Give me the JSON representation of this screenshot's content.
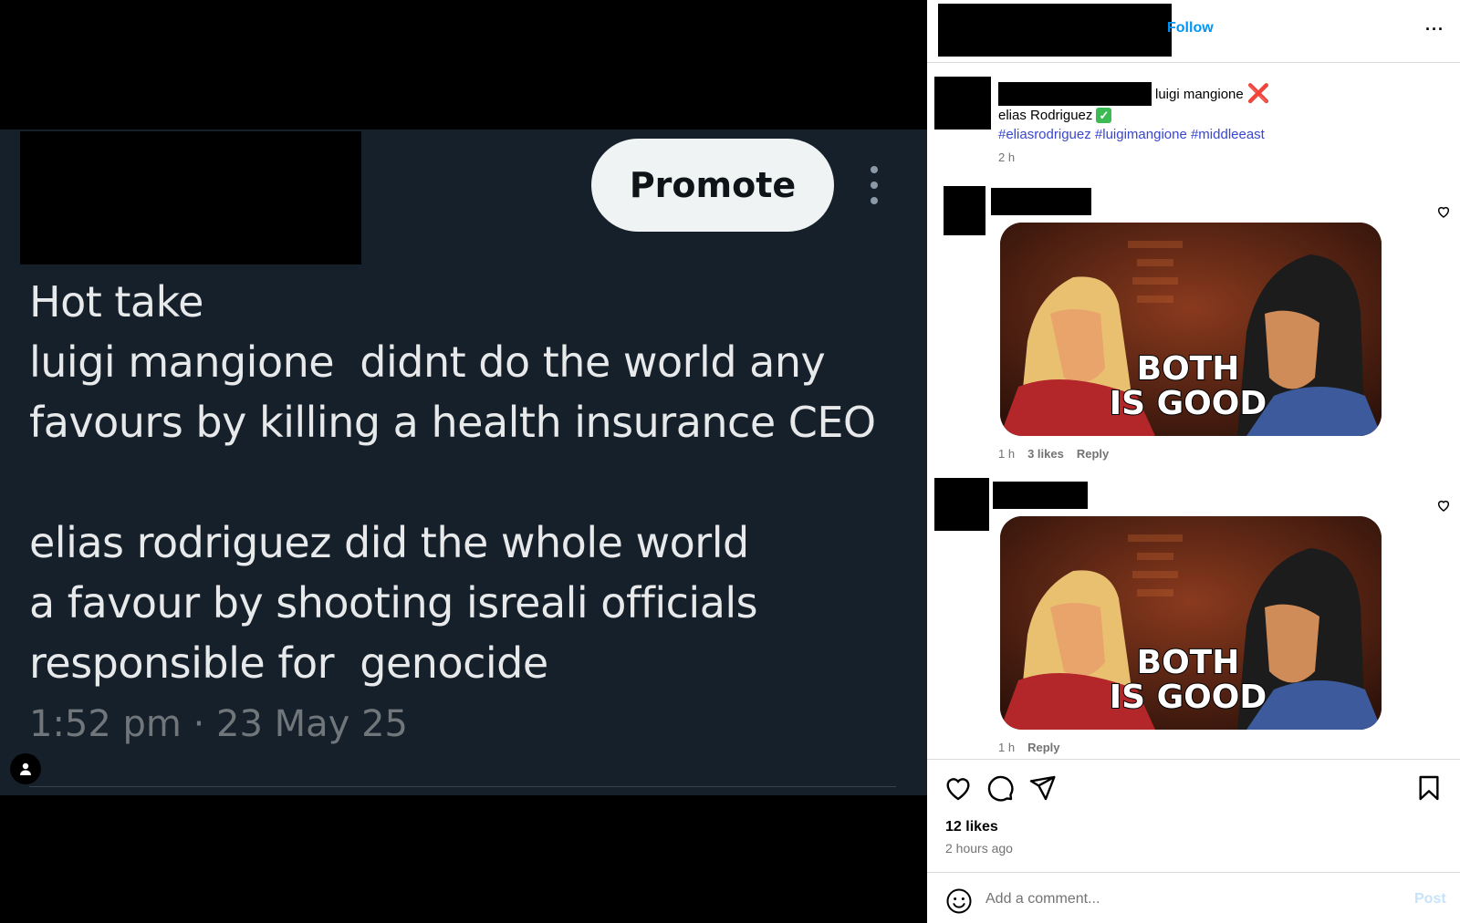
{
  "tweet": {
    "promote_label": "Promote",
    "lines_part1": [
      "Hot take",
      "luigi mangione  didnt do the world any",
      "favours by killing a health insurance CEO"
    ],
    "lines_part2": [
      "elias rodriguez did the whole world",
      "a favour by shooting isreali officials",
      "responsible for  genocide"
    ],
    "timestamp": "1:52 pm · 23 May 25"
  },
  "instagram": {
    "follow_label": "Follow",
    "more_label": "···",
    "caption": {
      "line1": "luigi mangione",
      "line1_mark": "❌",
      "line2": "elias Rodriguez",
      "line2_mark": "✓",
      "hashtags": "#eliasrodriguez #luigimangione #middleeast",
      "time": "2 h"
    },
    "comments": [
      {
        "meme_text_1": "BOTH",
        "meme_text_2": "IS GOOD",
        "time": "1 h",
        "likes": "3 likes",
        "reply": "Reply"
      },
      {
        "meme_text_1": "BOTH",
        "meme_text_2": "IS GOOD",
        "time": "1 h",
        "reply": "Reply"
      }
    ],
    "likes": "12 likes",
    "posted": "2 hours ago",
    "comment_placeholder": "Add a comment...",
    "post_label": "Post",
    "colors": {
      "link": "#0095f6",
      "hashtag": "#3846d0",
      "muted": "#737373",
      "tweet_bg": "#15202b"
    }
  }
}
